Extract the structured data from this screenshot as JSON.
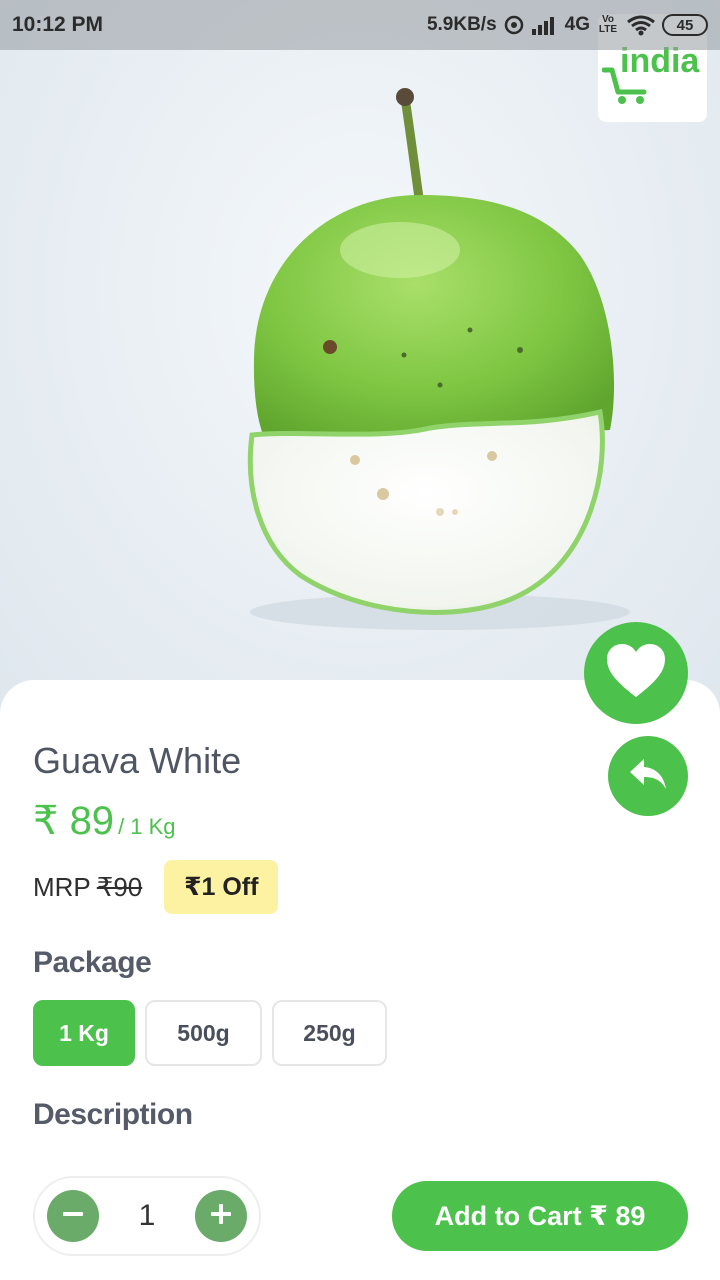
{
  "status_bar": {
    "time": "10:12 PM",
    "speed": "5.9KB/s",
    "network": "4G",
    "volte": "Vo LTE",
    "battery": "45"
  },
  "logo": {
    "text": "india",
    "icon": "cart-icon",
    "color": "#4cc14c"
  },
  "product": {
    "name": "Guava White",
    "price": "₹ 89",
    "unit": "/ 1 Kg",
    "mrp_label": "MRP",
    "mrp_value": "₹90",
    "discount": "₹1 Off"
  },
  "package": {
    "heading": "Package",
    "options": [
      "1 Kg",
      "500g",
      "250g"
    ],
    "selected": "1 Kg"
  },
  "description": {
    "heading": "Description"
  },
  "cart": {
    "quantity": "1",
    "add_label": "Add to Cart ₹ 89"
  },
  "actions": {
    "wishlist_icon": "heart-icon",
    "share_icon": "share-icon"
  },
  "colors": {
    "accent": "#4cc14c",
    "badge": "#fdf1a2",
    "stepper": "#6aab6a"
  }
}
